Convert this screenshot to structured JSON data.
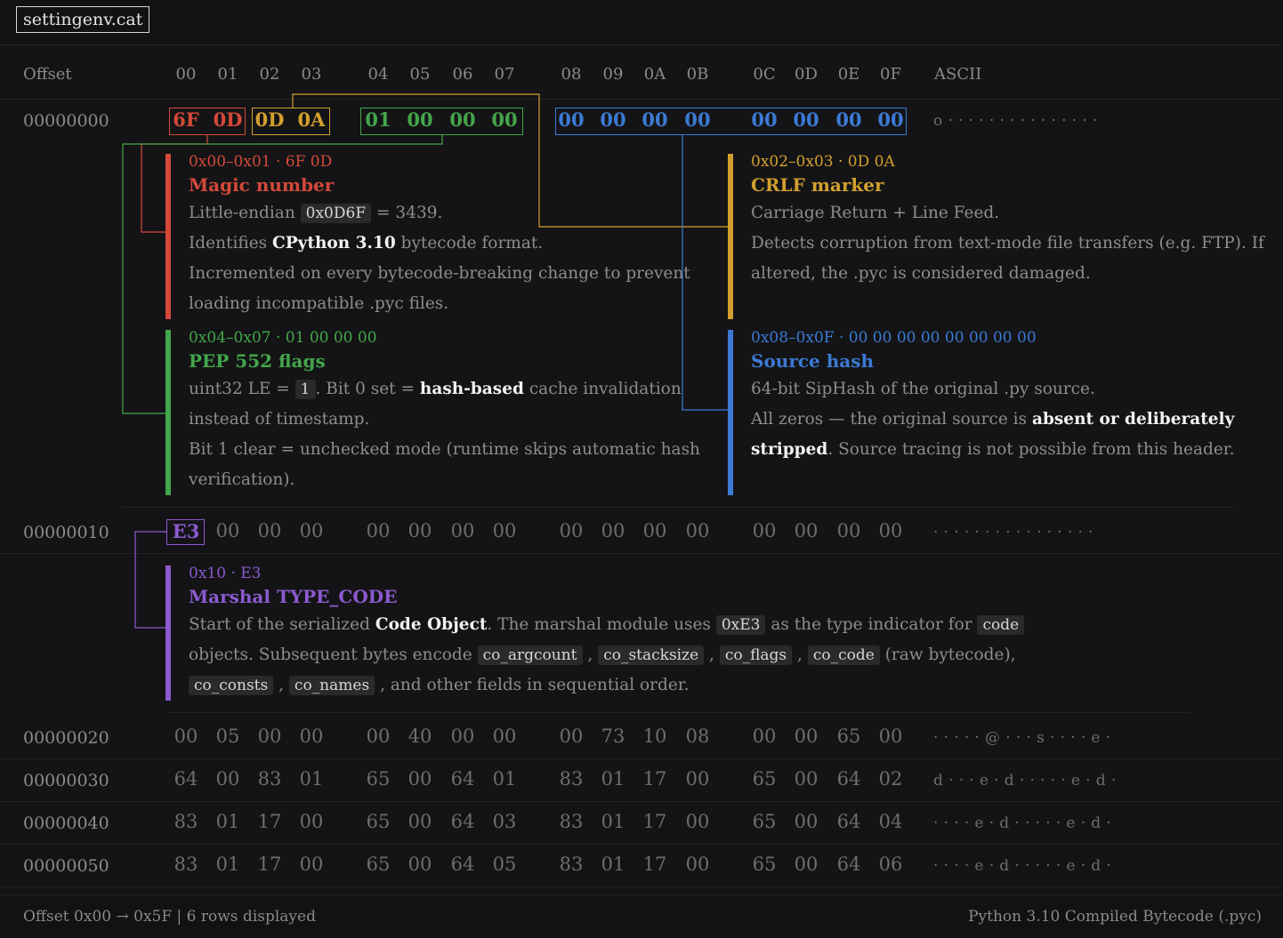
{
  "app": {
    "title": "settingenv.cat"
  },
  "colors": {
    "red": "#d4493a",
    "orange": "#d3a02e",
    "green": "#44a64a",
    "blue": "#3c7ad4",
    "purple": "#8c5ad0",
    "bg": "#141416"
  },
  "header": {
    "offset_label": "Offset",
    "columns": [
      "00",
      "01",
      "02",
      "03",
      "04",
      "05",
      "06",
      "07",
      "08",
      "09",
      "0A",
      "0B",
      "0C",
      "0D",
      "0E",
      "0F"
    ],
    "ascii_label": "ASCII"
  },
  "rows": [
    {
      "offset": "00000000",
      "bytes": [
        "6F",
        "0D",
        "0D",
        "0A",
        "01",
        "00",
        "00",
        "00",
        "00",
        "00",
        "00",
        "00",
        "00",
        "00",
        "00",
        "00"
      ],
      "ascii": "o · · · · · · · · · · · · · · ·"
    },
    {
      "offset": "00000010",
      "bytes": [
        "E3",
        "00",
        "00",
        "00",
        "00",
        "00",
        "00",
        "00",
        "00",
        "00",
        "00",
        "00",
        "00",
        "00",
        "00",
        "00"
      ],
      "ascii": "· · · · · · · · · · · · · · · ·"
    },
    {
      "offset": "00000020",
      "bytes": [
        "00",
        "05",
        "00",
        "00",
        "00",
        "40",
        "00",
        "00",
        "00",
        "73",
        "10",
        "08",
        "00",
        "00",
        "65",
        "00"
      ],
      "ascii": "· · · · · @ · · · s · · · · e ·"
    },
    {
      "offset": "00000030",
      "bytes": [
        "64",
        "00",
        "83",
        "01",
        "65",
        "00",
        "64",
        "01",
        "83",
        "01",
        "17",
        "00",
        "65",
        "00",
        "64",
        "02"
      ],
      "ascii": "d · · · e · d · · · · · e · d ·"
    },
    {
      "offset": "00000040",
      "bytes": [
        "83",
        "01",
        "17",
        "00",
        "65",
        "00",
        "64",
        "03",
        "83",
        "01",
        "17",
        "00",
        "65",
        "00",
        "64",
        "04"
      ],
      "ascii": "· · · · e · d · · · · · e · d ·"
    },
    {
      "offset": "00000050",
      "bytes": [
        "83",
        "01",
        "17",
        "00",
        "65",
        "00",
        "64",
        "05",
        "83",
        "01",
        "17",
        "00",
        "65",
        "00",
        "64",
        "06"
      ],
      "ascii": "· · · · e · d · · · · · e · d ·"
    }
  ],
  "annotations": {
    "magic": {
      "range": "0x00–0x01 · 6F 0D",
      "title": "Magic number",
      "l1a": "Little-endian",
      "l1code": "0x0D6F",
      "l1b": "= 3439.",
      "l2a": "Identifies",
      "l2b": "CPython 3.10",
      "l2c": "bytecode format.",
      "l3": "Incremented on every bytecode-breaking change to prevent",
      "l4": "loading incompatible .pyc files."
    },
    "crlf": {
      "range": "0x02–0x03 · 0D 0A",
      "title": "CRLF marker",
      "l1": "Carriage Return + Line Feed.",
      "l2": "Detects corruption from text-mode file transfers (e.g. FTP). If",
      "l3": "altered, the .pyc is considered damaged."
    },
    "flags": {
      "range": "0x04–0x07 · 01 00 00 00",
      "title": "PEP 552 flags",
      "l1a": "uint32 LE =",
      "l1code": "1",
      "l1b": ". Bit 0 set =",
      "l1bold": "hash-based",
      "l1c": "cache invalidation",
      "l2": "instead of timestamp.",
      "l3": "Bit 1 clear = unchecked mode (runtime skips automatic hash",
      "l4": "verification)."
    },
    "hash": {
      "range": "0x08–0x0F · 00 00 00 00 00 00 00 00",
      "title": "Source hash",
      "l1": "64-bit SipHash of the original .py source.",
      "l2a": "All zeros — the original source is",
      "l2bold": "absent or deliberately",
      "l3bold": "stripped",
      "l3b": ". Source tracing is not possible from this header."
    },
    "marshal": {
      "range": "0x10 · E3",
      "title": "Marshal TYPE_CODE",
      "l1a": "Start of the serialized",
      "l1bold": "Code Object",
      "l1b": ". The marshal module uses",
      "l1code": "0xE3",
      "l1c": "as the type indicator for",
      "l1code2": "code",
      "l2a": "objects. Subsequent bytes encode",
      "c1": "co_argcount",
      "c2": "co_stacksize",
      "c3": "co_flags",
      "c4": "co_code",
      "l2b": "(raw bytecode),",
      "c5": "co_consts",
      "c6": "co_names",
      "l3": ", and other fields in sequential order.",
      "comma": ","
    }
  },
  "footer": {
    "left": "Offset 0x00 → 0x5F | 6 rows displayed",
    "right": "Python 3.10 Compiled Bytecode (.pyc)"
  }
}
